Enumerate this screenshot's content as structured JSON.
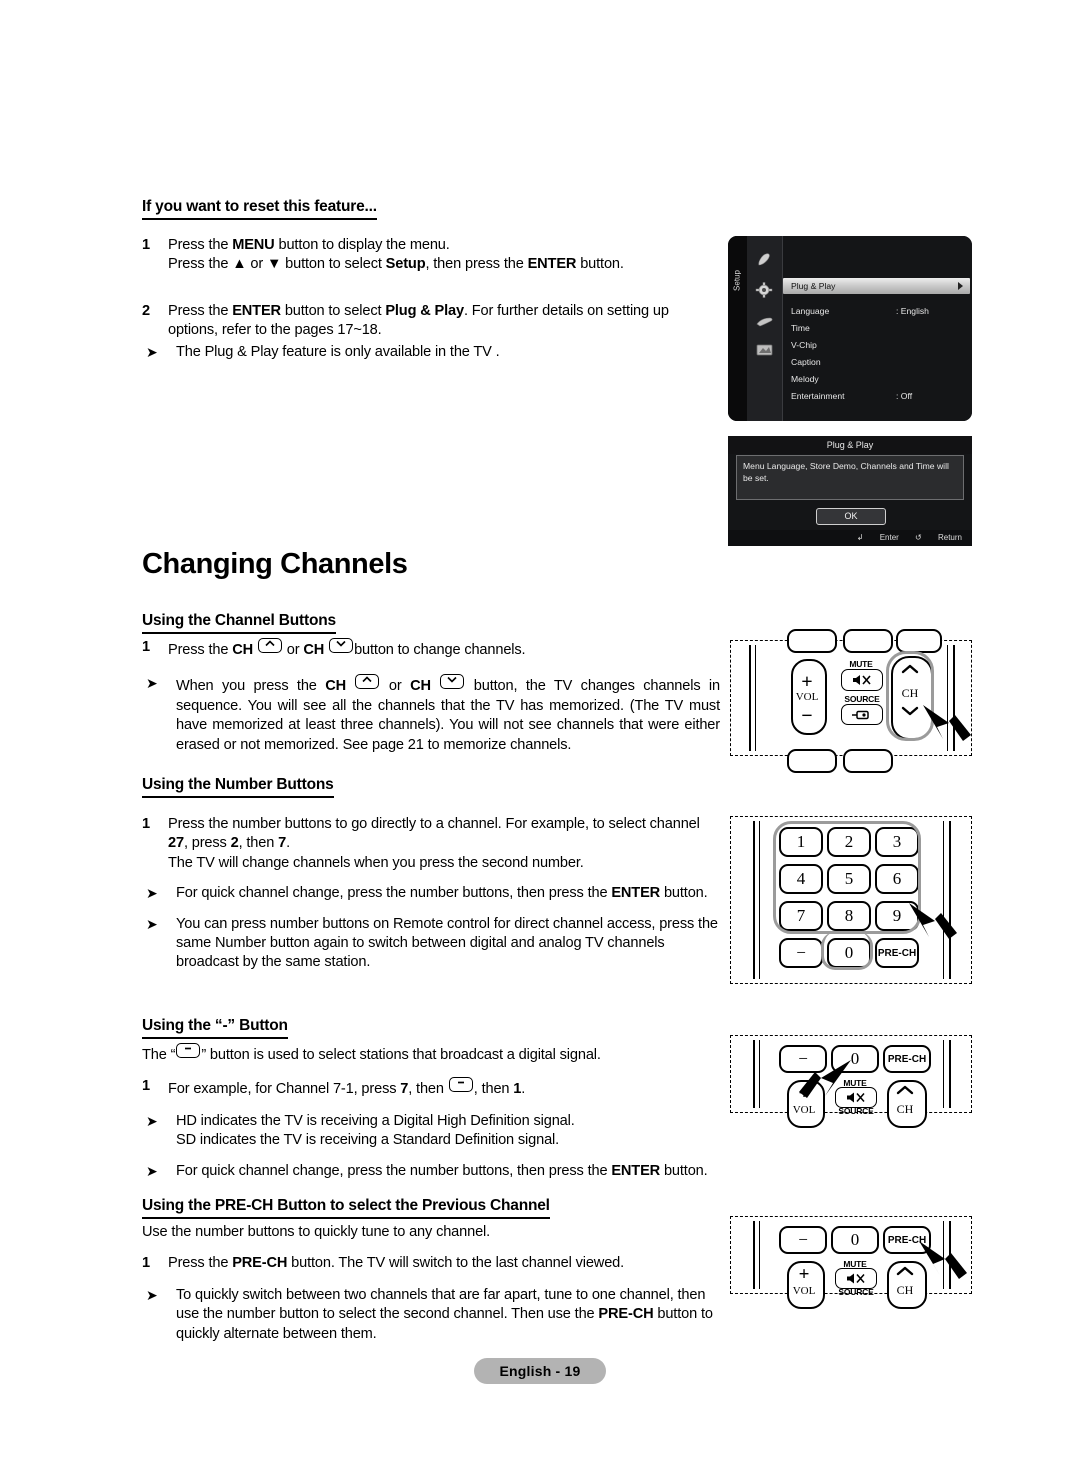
{
  "doc": {
    "footer_label": "English - 19",
    "page_title": "Changing Channels"
  },
  "reset_section": {
    "heading": "If you want to reset this feature...",
    "step1": {
      "num": "1",
      "line1_a": "Press the ",
      "line1_menu": "MENU",
      "line1_b": " button to display the menu.",
      "line2_a": "Press the ▲ or ▼ button to select ",
      "line2_setup": "Setup",
      "line2_b": ", then press the ",
      "line2_enter": "ENTER",
      "line2_c": " button."
    },
    "step2": {
      "num": "2",
      "a": "Press the ",
      "enter": "ENTER",
      "b": " button to select ",
      "plugplay": "Plug & Play",
      "c": ". For further details on setting up options, refer to the pages 17~18.",
      "note": "The Plug & Play feature is only available in the TV ."
    }
  },
  "osd": {
    "tab_label": "Setup",
    "selected": "Plug & Play",
    "icons": [
      "picture-icon",
      "setup-gear-icon",
      "sound-icon",
      "input-icon"
    ],
    "rows": [
      {
        "label": "Language",
        "value": ": English"
      },
      {
        "label": "Time",
        "value": ""
      },
      {
        "label": "V-Chip",
        "value": ""
      },
      {
        "label": "Caption",
        "value": ""
      },
      {
        "label": "Melody",
        "value": ""
      },
      {
        "label": "Entertainment",
        "value": ": Off"
      }
    ]
  },
  "dialog": {
    "title": "Plug & Play",
    "message": "Menu Language, Store Demo, Channels and Time will be set.",
    "ok": "OK",
    "enter": "Enter",
    "return": "Return"
  },
  "channel_buttons": {
    "heading": "Using the Channel Buttons",
    "step1": {
      "num": "1",
      "a": "Press the ",
      "ch1": "CH",
      "b": " or ",
      "ch2": "CH",
      "c": "button to change channels."
    },
    "note": {
      "a": "When you press the ",
      "ch1": "CH",
      "b": " or ",
      "ch2": "CH",
      "c": " button, the TV changes channels in sequence. You will see all the channels that the TV has memorized. (The TV must have memorized at least three channels). You will not see channels that were either erased or not memorized. See page 21 to memorize channels."
    }
  },
  "number_buttons": {
    "heading": "Using the Number Buttons",
    "step1": {
      "num": "1",
      "a": "Press the number buttons to go directly to a channel. For example, to select channel ",
      "ch": "27",
      "b": ", press ",
      "d1": "2",
      "c": ", then ",
      "d2": "7",
      "d": ".",
      "line2": "The TV will change channels when you press the second number."
    },
    "note1": {
      "a": "For quick channel change, press the number buttons, then press the ",
      "enter": "ENTER",
      "b": " button."
    },
    "note2": "You can press number buttons on Remote control for direct channel access, press the same Number button again to switch between digital and analog TV channels broadcast by the same station."
  },
  "minus_button": {
    "heading": "Using the “-” Button",
    "intro_a": "The “",
    "intro_b": "” button is used to select stations that broadcast a digital signal.",
    "step1": {
      "num": "1",
      "a": "For example, for Channel 7-1, press ",
      "d1": "7",
      "b": ", then ",
      "c": ", then ",
      "d2": "1",
      "d": "."
    },
    "note1_line1": "HD indicates the TV is receiving a Digital High Definition signal.",
    "note1_line2": "SD indicates the TV is receiving a Standard Definition signal.",
    "note2": {
      "a": "For quick channel change, press the number buttons, then press the ",
      "enter": "ENTER",
      "b": " button."
    }
  },
  "prech": {
    "heading_a": "Using the ",
    "heading_prech": "PRE-CH",
    "heading_b": " Button to select the Previous Channel",
    "intro": "Use the number buttons to quickly tune to any channel.",
    "step1": {
      "num": "1",
      "a": "Press the ",
      "prech": "PRE-CH",
      "b": " button. The TV will switch to the last channel viewed."
    },
    "note": {
      "a": "To quickly switch between two channels that are far apart, tune to one channel, then use the number button to select the second channel. Then use the ",
      "prech": "PRE-CH",
      "b": " button to quickly alternate between them."
    }
  },
  "remotes": {
    "ch_remote": {
      "vol": "VOL",
      "plus": "+",
      "minus": "−",
      "mute": "MUTE",
      "source": "SOURCE",
      "ch": "CH"
    },
    "numpad": {
      "keys": [
        "1",
        "2",
        "3",
        "4",
        "5",
        "6",
        "7",
        "8",
        "9"
      ],
      "minus": "−",
      "zero": "0",
      "prech": "PRE-CH"
    },
    "minus_remote": {
      "minus": "−",
      "zero": "0",
      "prech": "PRE-CH",
      "plus": "+",
      "vol": "VOL",
      "mute": "MUTE",
      "source": "SOURCE",
      "ch": "CH"
    },
    "prech_remote": {
      "minus": "−",
      "zero": "0",
      "prech": "PRE-CH",
      "plus": "+",
      "vol": "VOL",
      "mute": "MUTE",
      "source": "SOURCE",
      "ch": "CH"
    }
  },
  "colors": {
    "footer_pill": "#b3b3b3",
    "osd_bg": "#141517",
    "osd_selected": "#c9c9c9",
    "highlight_outline": "#9b9b9b"
  }
}
